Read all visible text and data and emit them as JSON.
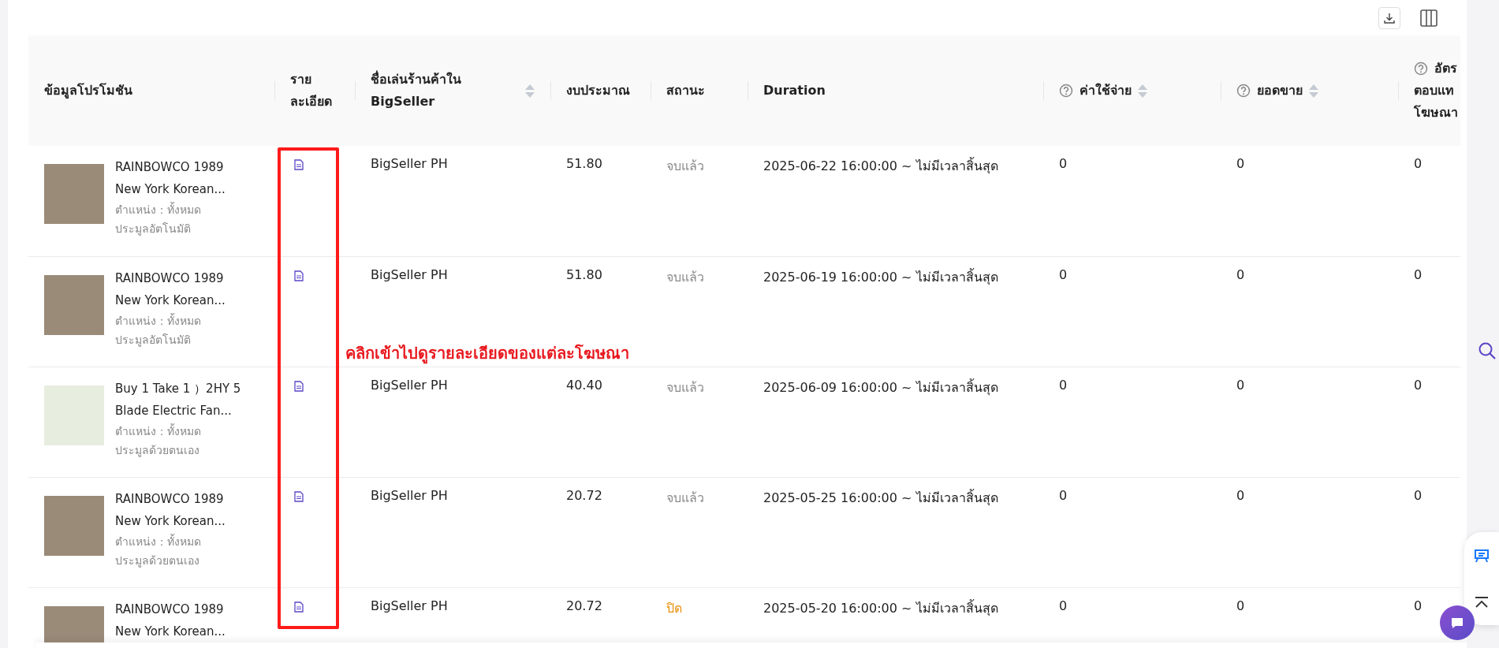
{
  "toolbar": {
    "buttons": [
      {
        "kind": "download"
      },
      {
        "kind": "columns"
      }
    ]
  },
  "table": {
    "columns": [
      {
        "lines": [
          "ข้อมูลโปรโมชัน"
        ]
      },
      {
        "lines": [
          "ราย",
          "ละเอียด"
        ]
      },
      {
        "lines": [
          "ชื่อเล่นร้านค้าใน",
          "BigSeller"
        ],
        "sortable": true
      },
      {
        "lines": [
          "งบประมาณ"
        ]
      },
      {
        "lines": [
          "สถานะ"
        ]
      },
      {
        "lines": [
          "Duration"
        ]
      },
      {
        "lines": [
          "ค่าใช้จ่าย"
        ],
        "sortable": true,
        "help": true
      },
      {
        "lines": [
          "ยอดขาย"
        ],
        "sortable": true,
        "help": true
      },
      {
        "lines": [
          "อัตร",
          "ตอบแท",
          "โฆษณา"
        ],
        "help": true
      }
    ],
    "rows": [
      {
        "title": "RAINBOWCO 1989 New York Korean...",
        "position": "ตำแหน่ง：ทั้งหมด",
        "bidding": "ประมูลอัตโนมัติ",
        "shop": "BigSeller PH",
        "budget": "51.80",
        "status": "จบแล้ว",
        "color": "#8c8c8c",
        "duration": "2025-06-22 16:00:00 ~ ไม่มีเวลาสิ้นสุด",
        "cost": "0",
        "sales": "0",
        "column_9": "0"
      },
      {
        "title": "RAINBOWCO 1989 New York Korean...",
        "position": "ตำแหน่ง：ทั้งหมด",
        "bidding": "ประมูลอัตโนมัติ",
        "shop": "BigSeller PH",
        "budget": "51.80",
        "status": "จบแล้ว",
        "color": "#8c8c8c",
        "duration": "2025-06-19 16:00:00 ~ ไม่มีเวลาสิ้นสุด",
        "cost": "0",
        "sales": "0",
        "column_9": "0"
      },
      {
        "title": "Buy 1 Take 1 ）2HY 5 Blade Electric Fan...",
        "position": "ตำแหน่ง：ทั้งหมด",
        "bidding": "ประมูลด้วยตนเอง",
        "shop": "BigSeller PH",
        "budget": "40.40",
        "status": "จบแล้ว",
        "color": "#8c8c8c",
        "duration": "2025-06-09 16:00:00 ~ ไม่มีเวลาสิ้นสุด",
        "cost": "0",
        "sales": "0",
        "column_9": "0"
      },
      {
        "title": "RAINBOWCO 1989 New York Korean...",
        "position": "ตำแหน่ง：ทั้งหมด",
        "bidding": "ประมูลด้วยตนเอง",
        "shop": "BigSeller PH",
        "budget": "20.72",
        "status": "จบแล้ว",
        "color": "#8c8c8c",
        "duration": "2025-05-25 16:00:00 ~ ไม่มีเวลาสิ้นสุด",
        "cost": "0",
        "sales": "0",
        "column_9": "0"
      },
      {
        "title": "RAINBOWCO 1989 New York Korean...",
        "shop": "BigSeller PH",
        "budget": "20.72",
        "status": "ปิด",
        "color": "#e8900c",
        "duration": "2025-05-20 16:00:00 ~ ไม่มีเวลาสิ้นสุด",
        "cost": "0",
        "sales": "0",
        "column_9": "0"
      }
    ]
  },
  "annotation": {
    "text": "คลิกเข้าไปดูรายละเอียดของแต่ละโฆษณา"
  }
}
